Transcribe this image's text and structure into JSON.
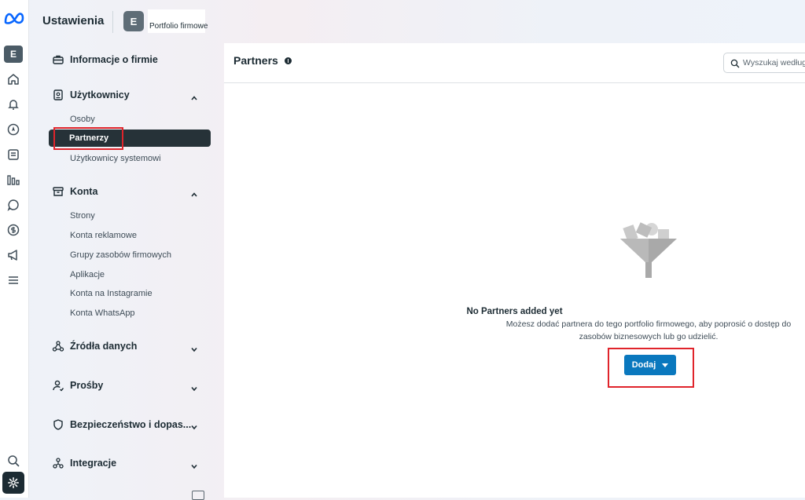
{
  "header": {
    "title": "Ustawienia",
    "business_initial": "E",
    "business_label": "Portfolio firmowe"
  },
  "rail": {
    "avatar_initial": "E",
    "icons": [
      "home-icon",
      "bell-icon",
      "compass-icon",
      "pages-icon",
      "bar-chart-icon",
      "chat-icon",
      "dollar-icon",
      "megaphone-icon",
      "menu-icon",
      "search-icon",
      "gear-icon"
    ]
  },
  "sidebar": {
    "company_info": "Informacje o firmie",
    "users": {
      "label": "Użytkownicy",
      "items": [
        "Osoby",
        "Partnerzy",
        "Użytkownicy systemowi"
      ]
    },
    "accounts": {
      "label": "Konta",
      "items": [
        "Strony",
        "Konta reklamowe",
        "Grupy zasobów firmowych",
        "Aplikacje",
        "Konta na Instagramie",
        "Konta WhatsApp"
      ]
    },
    "data_sources": "Źródła danych",
    "requests": "Prośby",
    "security": "Bezpieczeństwo i dopas...",
    "integrations": "Integracje"
  },
  "main": {
    "title": "Partners",
    "search_placeholder": "Wyszukaj według",
    "empty_title": "No Partners added yet",
    "empty_description": "Możesz dodać partnera do tego portfolio firmowego, aby poprosić o dostęp do zasobów biznesowych lub go udzielić.",
    "add_button": "Dodaj"
  },
  "colors": {
    "accent": "#0a78be",
    "active_item": "#263238",
    "highlight": "#e0242b"
  }
}
